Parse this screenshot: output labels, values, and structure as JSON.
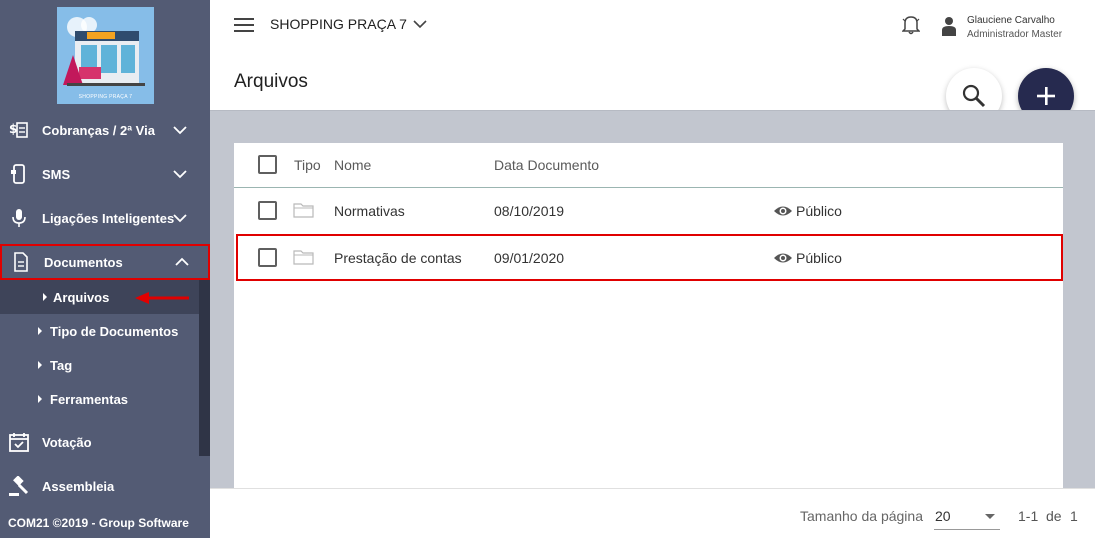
{
  "sidebar": {
    "logo_caption": "SHOPPING PRAÇA 7",
    "items": [
      {
        "label": "Cobranças / 2ª Via"
      },
      {
        "label": "SMS"
      },
      {
        "label": "Ligações Inteligentes"
      },
      {
        "label": "Documentos"
      },
      {
        "label": "Votação"
      },
      {
        "label": "Assembleia"
      }
    ],
    "submenu": [
      {
        "label": "Arquivos"
      },
      {
        "label": "Tipo de Documentos"
      },
      {
        "label": "Tag"
      },
      {
        "label": "Ferramentas"
      }
    ],
    "footer": "COM21 ©2019 - Group Software"
  },
  "header": {
    "company": "SHOPPING PRAÇA 7",
    "user_name": "Glauciene Carvalho",
    "user_role": "Administrador Master",
    "page_title": "Arquivos"
  },
  "table": {
    "columns": [
      "Tipo",
      "Nome",
      "Data Documento"
    ],
    "rows": [
      {
        "name": "Normativas",
        "date": "08/10/2019",
        "visibility": "Público"
      },
      {
        "name": "Prestação de contas",
        "date": "09/01/2020",
        "visibility": "Público"
      }
    ]
  },
  "pagination": {
    "label": "Tamanho da página",
    "size": "20",
    "range": "1-1",
    "of": "de",
    "total": "1"
  },
  "colors": {
    "sidebar": "#535b74",
    "accent_dark": "#262a4f",
    "highlight": "#e00000"
  }
}
